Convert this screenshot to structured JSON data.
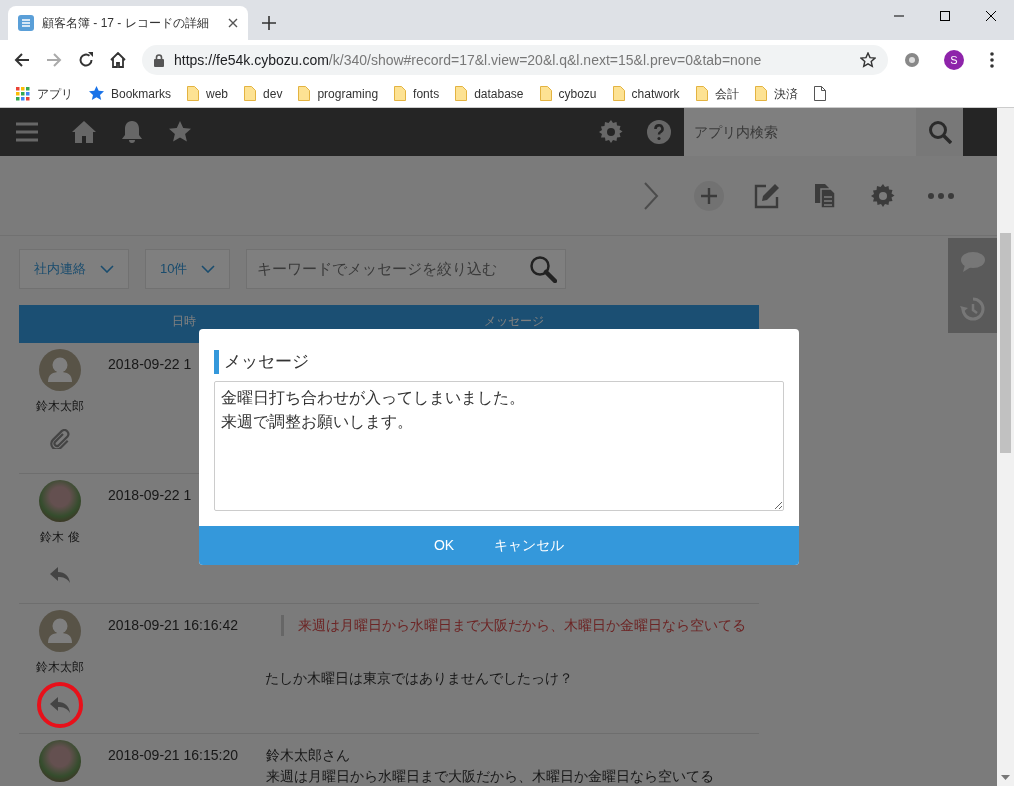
{
  "browser": {
    "tab_title": "顧客名簿 - 17 - レコードの詳細",
    "url_host": "https://fe54k.cybozu.com",
    "url_path": "/k/340/show#record=17&l.view=20&l.q&l.next=15&l.prev=0&tab=none",
    "profile_initial": "S",
    "bookmarks": [
      {
        "label": "アプリ",
        "kind": "apps"
      },
      {
        "label": "Bookmarks",
        "kind": "star"
      },
      {
        "label": "web",
        "kind": "folder"
      },
      {
        "label": "dev",
        "kind": "folder"
      },
      {
        "label": "programing",
        "kind": "folder"
      },
      {
        "label": "fonts",
        "kind": "folder"
      },
      {
        "label": "database",
        "kind": "folder"
      },
      {
        "label": "cybozu",
        "kind": "folder"
      },
      {
        "label": "chatwork",
        "kind": "folder"
      },
      {
        "label": "会計",
        "kind": "folder"
      },
      {
        "label": "決済",
        "kind": "folder"
      },
      {
        "kind": "page"
      }
    ]
  },
  "app_header": {
    "search_placeholder": "アプリ内検索"
  },
  "filters": {
    "category": "社内連絡",
    "count": "10件",
    "keyword_placeholder": "キーワードでメッセージを絞り込む"
  },
  "table": {
    "columns": [
      "日時",
      "メッセージ"
    ],
    "rows": [
      {
        "author": "鈴木太郎",
        "photo": false,
        "datetime": "2018-09-22 1",
        "attachment": true,
        "annotated": false
      },
      {
        "author": "鈴木 俊",
        "photo": true,
        "datetime": "2018-09-22 1",
        "attachment": false,
        "annotated": false
      },
      {
        "author": "鈴木太郎",
        "photo": false,
        "datetime": "2018-09-21 16:16:42",
        "quote": "来週は月曜日から水曜日まで大阪だから、木曜日か金曜日なら空いてる",
        "text": "たしか木曜日は東京ではありませんでしたっけ？",
        "attachment": false,
        "annotated": true
      },
      {
        "photo": true,
        "datetime": "2018-09-21 16:15:20",
        "mention": "鈴木太郎さん",
        "text": "来週は月曜日から水曜日まで大阪だから、木曜日か金曜日なら空いてる"
      }
    ]
  },
  "dialog": {
    "title": "メッセージ",
    "lines": [
      "金曜日打ち合わせが入ってしまいました。",
      "来週で調整お願いします。"
    ],
    "buttons": [
      "OK",
      "キャンセル"
    ]
  }
}
